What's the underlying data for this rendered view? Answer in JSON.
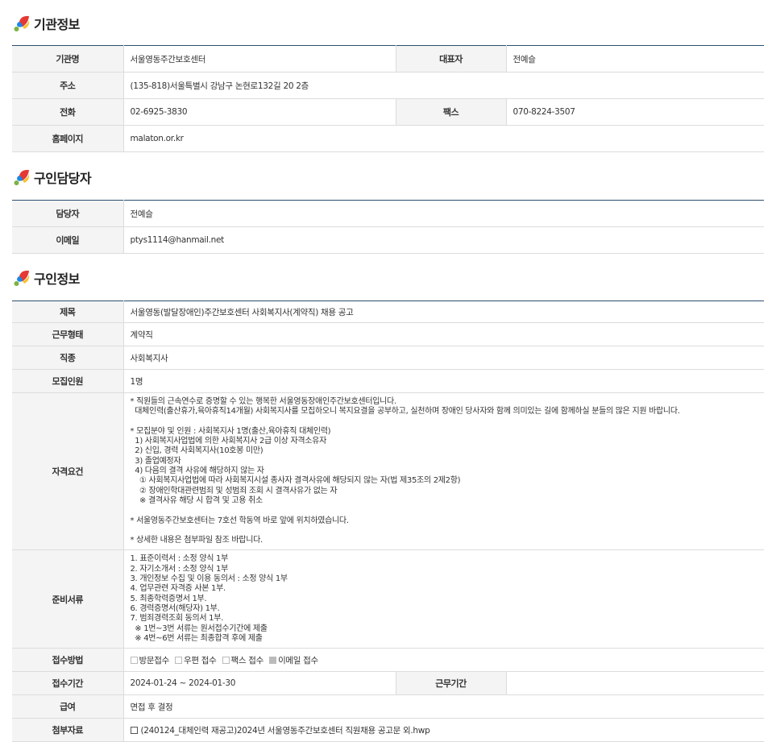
{
  "sections": {
    "org": {
      "title": "기관정보",
      "rows": {
        "name_label": "기관명",
        "name_value": "서울영동주간보호센터",
        "ceo_label": "대표자",
        "ceo_value": "전예슬",
        "addr_label": "주소",
        "addr_value": "(135-818)서울특별시 강남구 논현로132길 20 2층",
        "tel_label": "전화",
        "tel_value": "02-6925-3830",
        "fax_label": "팩스",
        "fax_value": "070-8224-3507",
        "home_label": "홈페이지",
        "home_value": "malaton.or.kr"
      }
    },
    "contact": {
      "title": "구인담당자",
      "rows": {
        "person_label": "담당자",
        "person_value": "전예슬",
        "email_label": "이메일",
        "email_value": "ptys1114@hanmail.net"
      }
    },
    "job": {
      "title": "구인정보",
      "rows": {
        "title_label": "제목",
        "title_value": "서울영동(발달장애인)주간보호센터 사회복지사(계약직) 채용 공고",
        "type_label": "근무형태",
        "type_value": "계약직",
        "kind_label": "직종",
        "kind_value": "사회복지사",
        "count_label": "모집인원",
        "count_value": "1명",
        "req_label": "자격요건",
        "req_value": "* 직원들의 근속연수로 증명할 수 있는 행복한 서울영동장애인주간보호센터입니다.\n  대체인력(출산휴가,육아휴직14개월) 사회복지사를 모집하오니 복지요결을 공부하고, 실천하며 장애인 당사자와 함께 의미있는 길에 함께하실 분들의 많은 지원 바랍니다.\n\n* 모집분야 및 인원 : 사회복지사 1명(출산,육아휴직 대체인력)\n  1) 사회복지사업법에 의한 사회복지사 2급 이상 자격소유자\n  2) 신입, 경력 사회복지사(10호봉 미만)\n  3) 졸업예정자\n  4) 다음의 결격 사유에 해당하지 않는 자\n    ① 사회복지사업법에 따라 사회복지시설 종사자 결격사유에 해당되지 않는 자(법 제35조의 2제2항)\n    ② 장애인학대관련범죄 및 성범죄 조회 시 결격사유가 없는 자\n    ※ 결격사유 해당 시 합격 및 고용 취소\n\n* 서울영동주간보호센터는 7호선 학동역 바로 앞에 위치하였습니다.\n\n* 상세한 내용은 첨부파일 참조 바랍니다.",
        "docs_label": "준비서류",
        "docs_value": "1. 표준이력서 : 소정 양식 1부\n2. 자기소개서 : 소정 양식 1부\n3. 개인정보 수집 및 이용 동의서 : 소정 양식 1부\n4. 업무관련 자격증 사본 1부.\n5. 최종학력증명서 1부.\n6. 경력증명서(해당자) 1부.\n7. 범죄경력조회 동의서 1부.\n  ※ 1번~3번 서류는 원서접수기간에 제출\n  ※ 4번~6번 서류는 최종합격 후에 제출",
        "method_label": "접수방법",
        "method_options": [
          "방문접수",
          "우편 접수",
          "팩스 접수",
          "이메일 접수"
        ],
        "period_label": "접수기간",
        "period_value": "2024-01-24 ~ 2024-01-30",
        "workperiod_label": "근무기간",
        "workperiod_value": "",
        "pay_label": "급여",
        "pay_value": "면접 후 결정",
        "file_label": "첨부자료",
        "file_value": "(240124_대체인력 재공고)2024년 서울영동주간보호센터 직원채용 공고문 외.hwp"
      }
    }
  },
  "colors": {
    "header_line": "#2d4f6e",
    "th_bg": "#f4f4f4",
    "border": "#dcdcdc"
  },
  "icons": {
    "section": "color-leaf-dot-icon",
    "file": "file-icon",
    "checkbox": "checkbox-icon"
  }
}
